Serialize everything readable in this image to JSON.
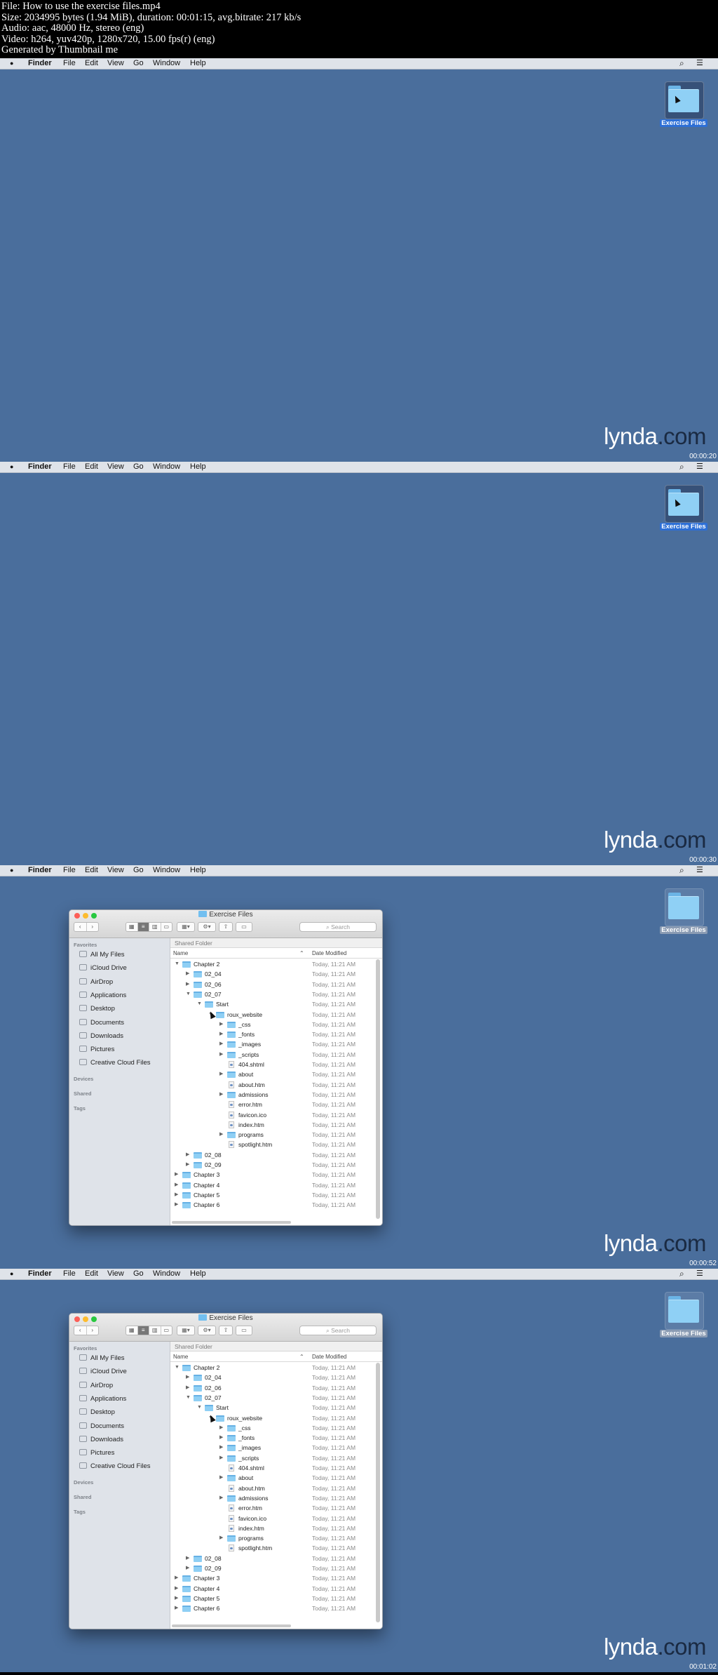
{
  "header": {
    "lines": [
      "File: How to use the exercise files.mp4",
      "Size: 2034995 bytes (1.94 MiB), duration: 00:01:15, avg.bitrate: 217 kb/s",
      "Audio: aac, 48000 Hz, stereo (eng)",
      "Video: h264, yuv420p, 1280x720, 15.00 fps(r) (eng)",
      "Generated by Thumbnail me"
    ]
  },
  "menubar": {
    "app": "Finder",
    "items": [
      "File",
      "Edit",
      "View",
      "Go",
      "Window",
      "Help"
    ]
  },
  "desktop_icon": {
    "label": "Exercise Files",
    "icon": "folder-icon"
  },
  "logo": {
    "text_a": "lynda",
    "text_b": ".com"
  },
  "timestamps": [
    "00:00:20",
    "00:00:30",
    "00:00:52",
    "00:01:02"
  ],
  "finder": {
    "title": "Exercise Files",
    "search_placeholder": "Search",
    "toolbar_icons": [
      "back-icon",
      "forward-icon",
      "icon-view-icon",
      "list-view-icon",
      "column-view-icon",
      "cover-flow-icon",
      "arrange-icon",
      "action-gear-icon",
      "share-icon",
      "tag-icon"
    ],
    "sidebar": {
      "favorites_header": "Favorites",
      "favorites": [
        "All My Files",
        "iCloud Drive",
        "AirDrop",
        "Applications",
        "Desktop",
        "Documents",
        "Downloads",
        "Pictures",
        "Creative Cloud Files"
      ],
      "devices_header": "Devices",
      "shared_header": "Shared",
      "tags_header": "Tags"
    },
    "location": "Shared Folder",
    "columns": {
      "name": "Name",
      "date": "Date Modified"
    },
    "rows": [
      {
        "name": "Chapter 2",
        "date": "Today, 11:21 AM",
        "level": 0,
        "expander": "open",
        "kind": "folder"
      },
      {
        "name": "02_04",
        "date": "Today, 11:21 AM",
        "level": 1,
        "expander": "closed",
        "kind": "folder"
      },
      {
        "name": "02_06",
        "date": "Today, 11:21 AM",
        "level": 1,
        "expander": "closed",
        "kind": "folder"
      },
      {
        "name": "02_07",
        "date": "Today, 11:21 AM",
        "level": 1,
        "expander": "open",
        "kind": "folder"
      },
      {
        "name": "Start",
        "date": "Today, 11:21 AM",
        "level": 2,
        "expander": "open",
        "kind": "folder"
      },
      {
        "name": "roux_website",
        "date": "Today, 11:21 AM",
        "level": 3,
        "expander": "open",
        "kind": "folder"
      },
      {
        "name": "_css",
        "date": "Today, 11:21 AM",
        "level": 4,
        "expander": "closed",
        "kind": "folder"
      },
      {
        "name": "_fonts",
        "date": "Today, 11:21 AM",
        "level": 4,
        "expander": "closed",
        "kind": "folder"
      },
      {
        "name": "_images",
        "date": "Today, 11:21 AM",
        "level": 4,
        "expander": "closed",
        "kind": "folder"
      },
      {
        "name": "_scripts",
        "date": "Today, 11:21 AM",
        "level": 4,
        "expander": "closed",
        "kind": "folder"
      },
      {
        "name": "404.shtml",
        "date": "Today, 11:21 AM",
        "level": 4,
        "expander": "none",
        "kind": "file"
      },
      {
        "name": "about",
        "date": "Today, 11:21 AM",
        "level": 4,
        "expander": "closed",
        "kind": "folder"
      },
      {
        "name": "about.htm",
        "date": "Today, 11:21 AM",
        "level": 4,
        "expander": "none",
        "kind": "file"
      },
      {
        "name": "admissions",
        "date": "Today, 11:21 AM",
        "level": 4,
        "expander": "closed",
        "kind": "folder"
      },
      {
        "name": "error.htm",
        "date": "Today, 11:21 AM",
        "level": 4,
        "expander": "none",
        "kind": "file"
      },
      {
        "name": "favicon.ico",
        "date": "Today, 11:21 AM",
        "level": 4,
        "expander": "none",
        "kind": "file"
      },
      {
        "name": "index.htm",
        "date": "Today, 11:21 AM",
        "level": 4,
        "expander": "none",
        "kind": "file"
      },
      {
        "name": "programs",
        "date": "Today, 11:21 AM",
        "level": 4,
        "expander": "closed",
        "kind": "folder"
      },
      {
        "name": "spotlight.htm",
        "date": "Today, 11:21 AM",
        "level": 4,
        "expander": "none",
        "kind": "file"
      },
      {
        "name": "02_08",
        "date": "Today, 11:21 AM",
        "level": 1,
        "expander": "closed",
        "kind": "folder"
      },
      {
        "name": "02_09",
        "date": "Today, 11:21 AM",
        "level": 1,
        "expander": "closed",
        "kind": "folder"
      },
      {
        "name": "Chapter 3",
        "date": "Today, 11:21 AM",
        "level": 0,
        "expander": "closed",
        "kind": "folder"
      },
      {
        "name": "Chapter 4",
        "date": "Today, 11:21 AM",
        "level": 0,
        "expander": "closed",
        "kind": "folder"
      },
      {
        "name": "Chapter 5",
        "date": "Today, 11:21 AM",
        "level": 0,
        "expander": "closed",
        "kind": "folder"
      },
      {
        "name": "Chapter 6",
        "date": "Today, 11:21 AM",
        "level": 0,
        "expander": "closed",
        "kind": "folder"
      }
    ]
  },
  "frames": [
    {
      "timestamp": "00:00:20",
      "finder_open": false,
      "icon_selected": true
    },
    {
      "timestamp": "00:00:30",
      "finder_open": false,
      "icon_selected": true
    },
    {
      "timestamp": "00:00:52",
      "finder_open": true,
      "icon_selected": false
    },
    {
      "timestamp": "00:01:02",
      "finder_open": true,
      "icon_selected": false
    }
  ],
  "colors": {
    "desktop": "#4a6e9c",
    "menubar": "#dfe3e9",
    "sidebar": "#dfe3e9",
    "selection": "#2d6fd6",
    "folder": "#8fd0f5"
  }
}
